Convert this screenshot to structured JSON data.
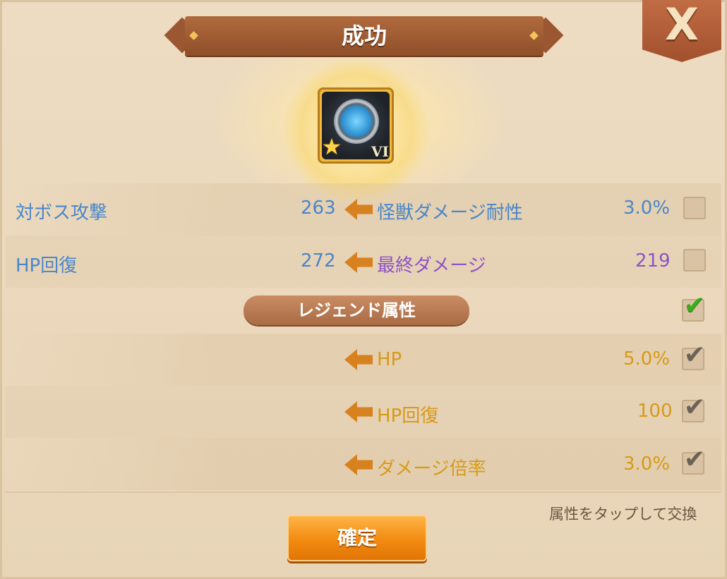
{
  "dialog": {
    "title": "成功",
    "close_label": "X"
  },
  "item": {
    "rank": "VI",
    "star_icon": "star-icon",
    "gem_icon": "blue-gem-amulet-icon"
  },
  "stats": [
    {
      "old_label": "対ボス攻撃",
      "old_value": "263",
      "new_label": "怪獣ダメージ耐性",
      "new_value": "3.0%",
      "checked": false
    },
    {
      "old_label": "HP回復",
      "old_value": "272",
      "new_label": "最終ダメージ",
      "new_value": "219",
      "checked": false
    }
  ],
  "legend": {
    "label": "レジェンド属性",
    "checked": true,
    "items": [
      {
        "label": "HP",
        "value": "5.0%"
      },
      {
        "label": "HP回復",
        "value": "100"
      },
      {
        "label": "ダメージ倍率",
        "value": "3.0%"
      }
    ]
  },
  "hint": "属性をタップして交換",
  "confirm_label": "確定",
  "colors": {
    "stat_blue": "#4a86c9",
    "stat_purple": "#8f52c4",
    "legend_gold": "#d79a18",
    "arrow_orange": "#d8821f",
    "check_green": "#3cab1d"
  }
}
